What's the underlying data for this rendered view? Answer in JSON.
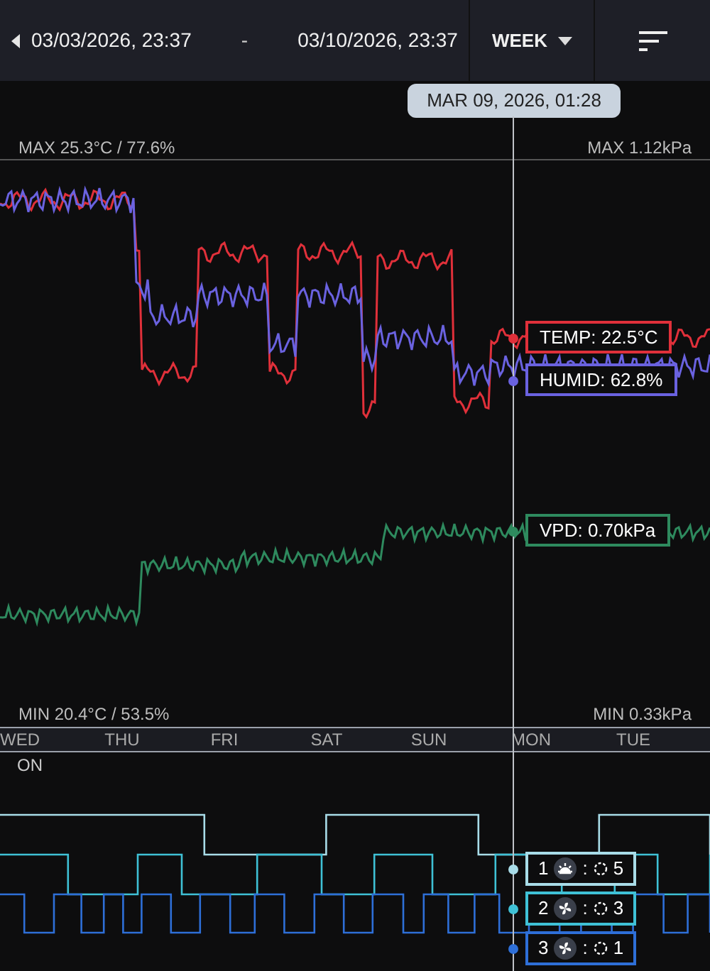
{
  "header": {
    "start": "03/03/2026, 23:37",
    "separator": "-",
    "end": "03/10/2026, 23:37",
    "range": "WEEK"
  },
  "cursor": {
    "time": "MAR 09, 2026, 01:28"
  },
  "scale": {
    "max_left": "MAX 25.3°C / 77.6%",
    "max_right": "MAX 1.12kPa",
    "min_left": "MIN 20.4°C / 53.5%",
    "min_right": "MIN 0.33kPa"
  },
  "readouts": [
    {
      "label": "TEMP: 22.5°C",
      "color": "#e0303a"
    },
    {
      "label": "HUMID: 62.8%",
      "color": "#6a62e0"
    },
    {
      "label": "VPD: 0.70kPa",
      "color": "#2e8a5e"
    }
  ],
  "days": [
    "WED",
    "THU",
    "FRI",
    "SAT",
    "SUN",
    "MON",
    "TUE"
  ],
  "state_label": "ON",
  "channels": [
    {
      "number": "1",
      "kind": "light",
      "separator": ":",
      "value": "5",
      "color": "#a8dce8"
    },
    {
      "number": "2",
      "kind": "fan",
      "separator": ":",
      "value": "3",
      "color": "#3fc1d6"
    },
    {
      "number": "3",
      "kind": "fan",
      "separator": ":",
      "value": "1",
      "color": "#2e6fd8"
    }
  ]
}
